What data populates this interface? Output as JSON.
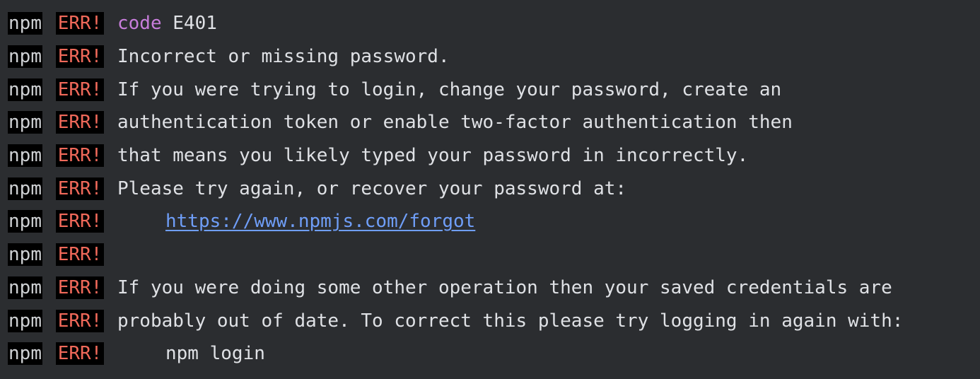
{
  "prefix": {
    "npm": "npm",
    "err": "ERR!"
  },
  "lines": [
    {
      "keyword": "code",
      "text": " E401"
    },
    {
      "text": "Incorrect or missing password."
    },
    {
      "text": "If you were trying to login, change your password, create an"
    },
    {
      "text": "authentication token or enable two-factor authentication then"
    },
    {
      "text": "that means you likely typed your password in incorrectly."
    },
    {
      "text": "Please try again, or recover your password at:"
    },
    {
      "link": "https://www.npmjs.com/forgot"
    },
    {
      "text": ""
    },
    {
      "text": "If you were doing some other operation then your saved credentials are"
    },
    {
      "text": "probably out of date. To correct this please try logging in again with:"
    },
    {
      "text": "npm login"
    }
  ],
  "colors": {
    "background": "#2b2d30",
    "text": "#dfe1e5",
    "err": "#f0695a",
    "keyword": "#c77dda",
    "link": "#6f9ef8"
  }
}
